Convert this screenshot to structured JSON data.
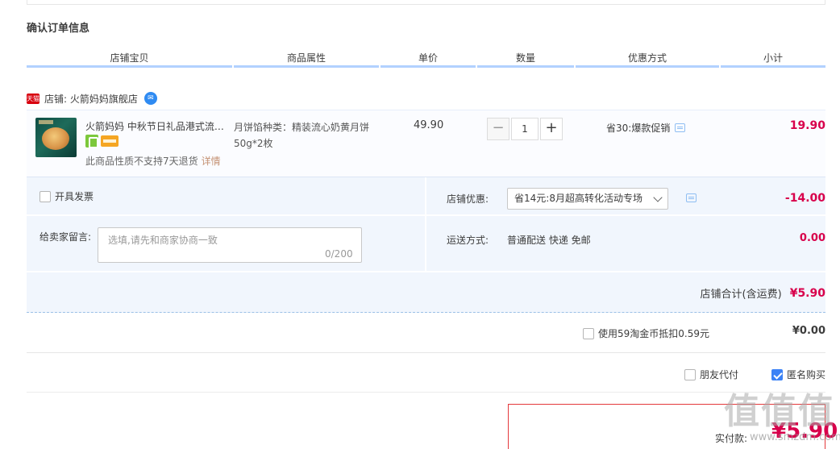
{
  "section_title": "确认订单信息",
  "columns": [
    "店铺宝贝",
    "商品属性",
    "单价",
    "数量",
    "优惠方式",
    "小计"
  ],
  "shop": {
    "badge": "天猫",
    "name": "店铺: 火箭妈妈旗舰店"
  },
  "item": {
    "title": "火箭妈妈 中秋节日礼品港式流心奶黄月饼礼盒",
    "no_return": "此商品性质不支持7天退货",
    "detail_link": "详情",
    "attribute": "月饼馅种类：精装流心奶黄月饼50g*2枚",
    "unit_price": "49.90",
    "quantity": "1",
    "qty_minus": "−",
    "qty_plus": "+",
    "promotion": "省30:爆款促销",
    "subtotal": "19.90"
  },
  "options": {
    "invoice_label": "开具发票",
    "message_label": "给卖家留言:",
    "message_placeholder": "选填,请先和商家协商一致",
    "message_count": "0/200",
    "shop_discount_label": "店铺优惠:",
    "shop_discount_selected": "省14元:8月超高转化活动专场",
    "shop_discount_value": "-14.00",
    "shipping_label": "运送方式:",
    "shipping_value": "普通配送 快递 免邮",
    "shipping_fee": "0.00"
  },
  "shop_total": {
    "label": "店铺合计(含运费)",
    "value": "¥5.90"
  },
  "coins": {
    "label": "使用59淘金币抵扣0.59元",
    "value": "¥0.00"
  },
  "extras": {
    "friend_pay": "朋友代付",
    "anonymous": "匿名购买"
  },
  "payment": {
    "label": "实付款:",
    "value": "¥5.90"
  },
  "watermark": {
    "logo": "值值值",
    "site": "www.smzdm.com"
  },
  "colors": {
    "accent_red": "#d8004b",
    "header_underline": "#b2d1ff",
    "panel_bg": "#f1f6fd",
    "checkbox_blue": "#3b82f6"
  }
}
